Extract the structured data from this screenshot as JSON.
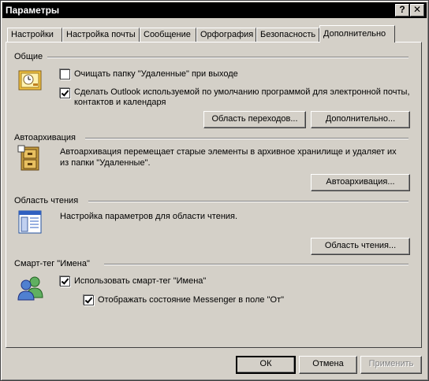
{
  "window": {
    "title": "Параметры",
    "help_glyph": "?",
    "close_glyph": "✕"
  },
  "tabs": [
    {
      "label": "Настройки"
    },
    {
      "label": "Настройка почты"
    },
    {
      "label": "Сообщение"
    },
    {
      "label": "Орфография"
    },
    {
      "label": "Безопасность"
    },
    {
      "label": "Дополнительно",
      "active": true
    }
  ],
  "general": {
    "heading": "Общие",
    "empty_deleted": {
      "label": "Очищать папку \"Удаленные\" при выходе",
      "checked": false
    },
    "default_outlook": {
      "label_line1": "Сделать Outlook используемой по умолчанию программой для электронной почты,",
      "label_line2": "контактов и календаря",
      "checked": true
    },
    "nav_pane_button": "Область переходов...",
    "advanced_button": "Дополнительно..."
  },
  "autoarchive": {
    "heading": "Автоархивация",
    "description_line1": "Автоархивация перемещает старые элементы в архивное хранилище и удаляет их",
    "description_line2": "из папки \"Удаленные\".",
    "button": "Автоархивация..."
  },
  "reading_pane": {
    "heading": "Область чтения",
    "description": "Настройка параметров для области чтения.",
    "button": "Область чтения..."
  },
  "smart_tag": {
    "heading": "Смарт-тег \"Имена\"",
    "use_smart_tag": {
      "label": "Использовать смарт-тег \"Имена\"",
      "checked": true
    },
    "show_messenger": {
      "label": "Отображать состояние Messenger в поле \"От\"",
      "checked": true
    }
  },
  "footer": {
    "ok": "ОК",
    "cancel": "Отмена",
    "apply": "Применить"
  },
  "icons": {
    "general": "general-settings-icon",
    "autoarchive": "archive-cabinet-icon",
    "reading_pane": "reading-pane-icon",
    "smart_tag": "people-icon"
  }
}
